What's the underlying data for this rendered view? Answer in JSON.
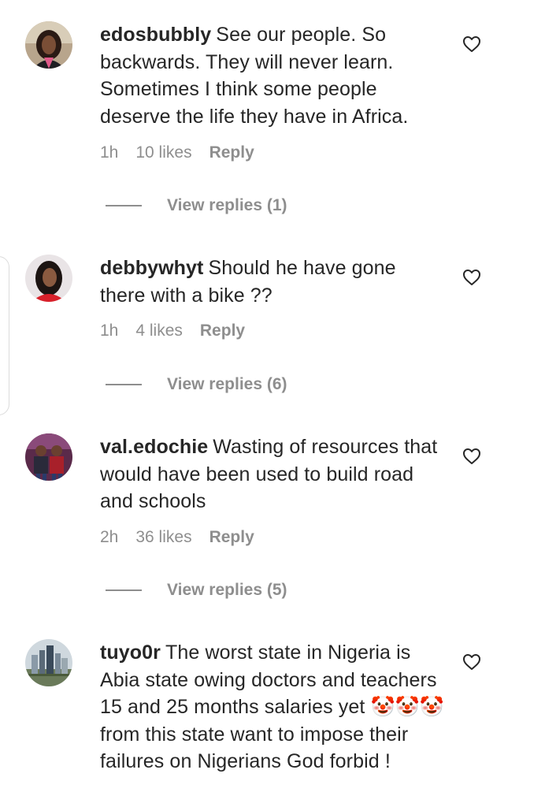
{
  "comments": [
    {
      "username": "edosbubbly",
      "text": "See our people. So backwards. They will never learn. Sometimes I think some people deserve the life they have in Africa.",
      "time": "1h",
      "likes": "10 likes",
      "reply": "Reply",
      "view_replies": "View replies (1)"
    },
    {
      "username": "debbywhyt",
      "text": "Should he have gone there with a bike ??",
      "time": "1h",
      "likes": "4 likes",
      "reply": "Reply",
      "view_replies": "View replies (6)"
    },
    {
      "username": "val.edochie",
      "text": "Wasting of resources that would have been used to build road and schools",
      "time": "2h",
      "likes": "36 likes",
      "reply": "Reply",
      "view_replies": "View replies (5)"
    },
    {
      "username": "tuyo0r",
      "text": "The worst state in Nigeria is Abia state owing doctors and teachers 15 and 25 months salaries yet 🤡🤡🤡from this state want to impose their failures on Nigerians God forbid !"
    }
  ],
  "icons": {
    "like": "heart-outline-icon"
  },
  "colors": {
    "text": "#262626",
    "secondary": "#8e8e8e"
  }
}
